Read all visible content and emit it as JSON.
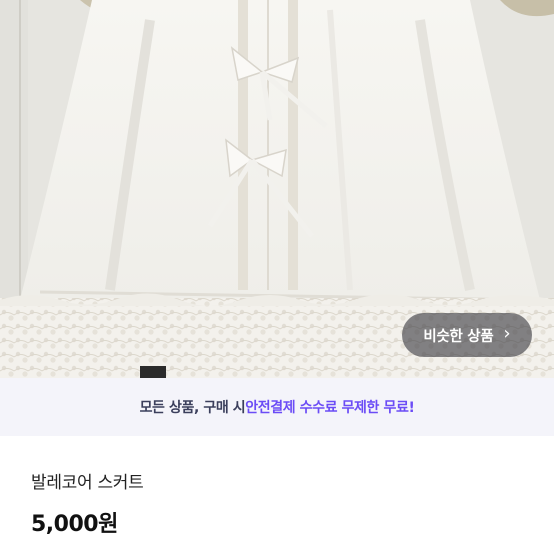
{
  "product_image": {
    "alt": ""
  },
  "similar_button": {
    "label": "비슷한 상품",
    "chevron": "›"
  },
  "banner": {
    "prefix": "모든 상품, 구매 시 ",
    "highlight": "안전결제 수수료 무제한 무료!"
  },
  "product": {
    "title": "발레코어 스커트",
    "price": "5,000원"
  },
  "colors": {
    "accent": "#6b4cf6",
    "banner_bg": "#f4f4fa",
    "banner_text": "#3b3f5c"
  },
  "icons": {
    "similar_chevron": "chevron-right-icon"
  }
}
